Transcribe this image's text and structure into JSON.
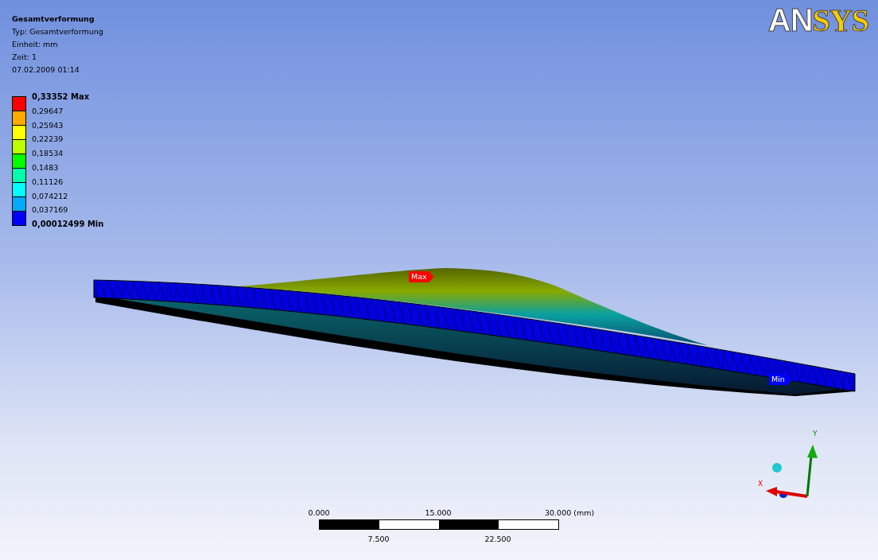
{
  "result": {
    "title": "Gesamtverformung",
    "details": [
      "Typ: Gesamtverformung",
      "Einheit: mm",
      "Zeit: 1",
      "07.02.2009 01:14"
    ]
  },
  "legend": {
    "labels": [
      {
        "text": "0,33352 Max",
        "kind": "extreme"
      },
      {
        "text": "0,29647",
        "kind": "step"
      },
      {
        "text": "0,25943",
        "kind": "step"
      },
      {
        "text": "0,22239",
        "kind": "step"
      },
      {
        "text": "0,18534",
        "kind": "step"
      },
      {
        "text": "0,1483",
        "kind": "step"
      },
      {
        "text": "0,11126",
        "kind": "step"
      },
      {
        "text": "0,074212",
        "kind": "step"
      },
      {
        "text": "0,037169",
        "kind": "step"
      },
      {
        "text": "0,00012499 Min",
        "kind": "extreme"
      }
    ],
    "bands": [
      {
        "color": "#ff0000"
      },
      {
        "color": "#ffaa00"
      },
      {
        "color": "#ffff00"
      },
      {
        "color": "#bbff00"
      },
      {
        "color": "#00ff00"
      },
      {
        "color": "#00ffaa"
      },
      {
        "color": "#00ffff"
      },
      {
        "color": "#00aaff"
      },
      {
        "color": "#0000ff"
      }
    ]
  },
  "logo": [
    {
      "text": "AN",
      "color": "#ffffff"
    },
    {
      "text": "SYS",
      "color": "#ffcc00"
    }
  ],
  "probes": [
    {
      "label": "Max",
      "color": "#ff0000"
    },
    {
      "label": "Min",
      "color": "#0000ff"
    }
  ],
  "triad": {
    "x_label": "X",
    "y_label": "Y"
  },
  "scale_bar": {
    "top_labels": [
      "0.000",
      "15.000",
      "30.000 (mm)"
    ],
    "bottom_labels": [
      "7.500",
      "22.500"
    ]
  }
}
